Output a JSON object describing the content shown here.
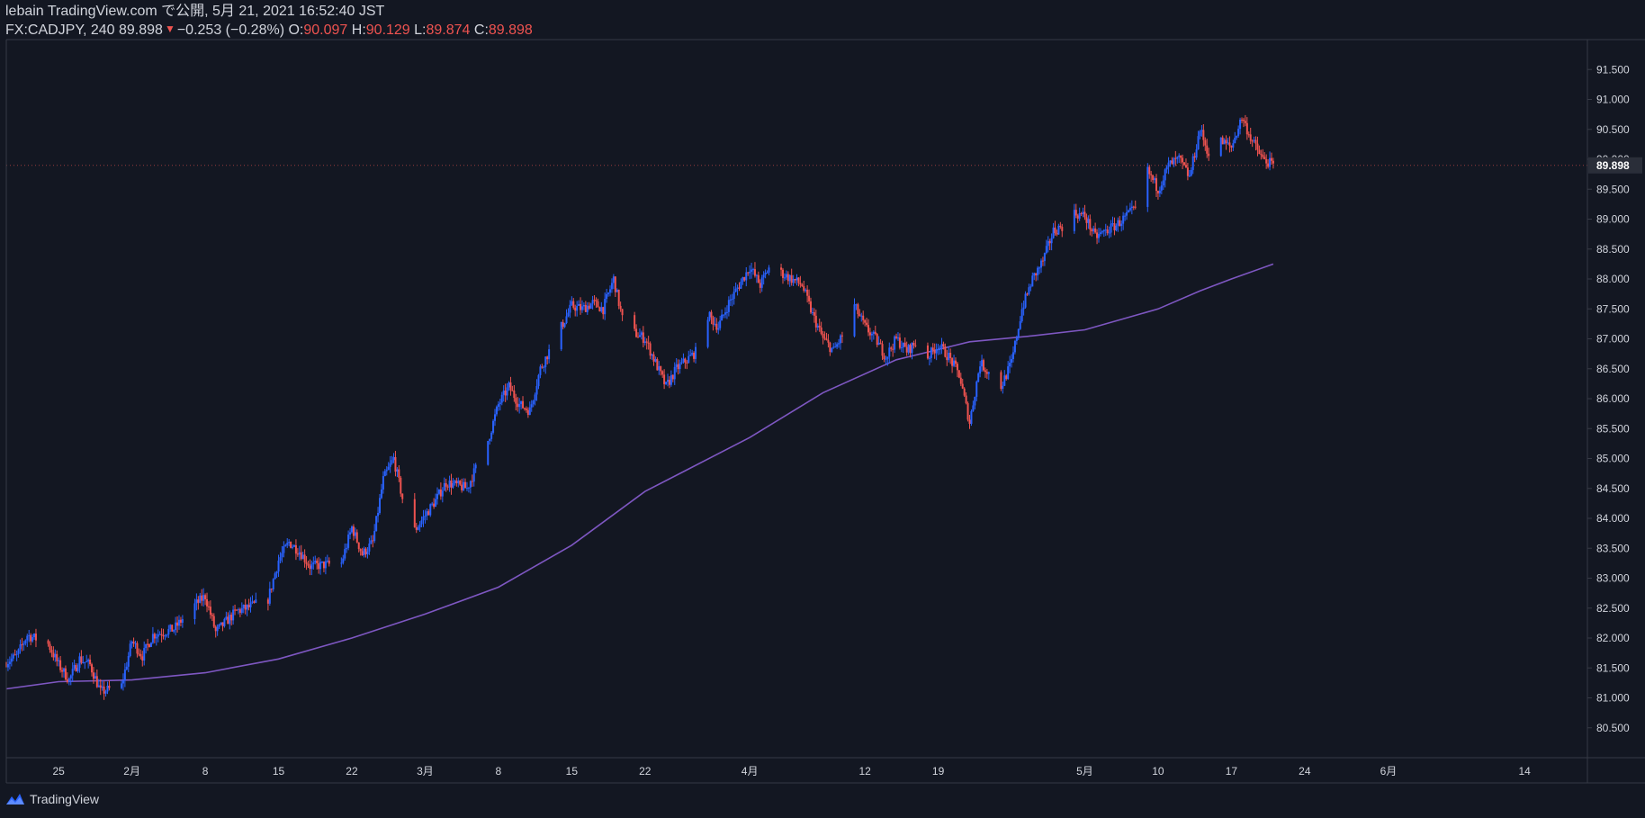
{
  "header": {
    "publish_line": "lebain TradingView.com で公開, 5月 21, 2021 16:52:40 JST",
    "symbol_interval": "FX:CADJPY, 240",
    "last_price": "89.898",
    "change": "−0.253 (−0.28%)",
    "open_label": "O:",
    "open_value": "90.097",
    "high_label": "H:",
    "high_value": "90.129",
    "low_label": "L:",
    "low_value": "89.874",
    "close_label": "C:",
    "close_value": "89.898",
    "down_icon": "triangle-down-icon"
  },
  "footer": {
    "brand": "TradingView",
    "icon": "tradingview-logo-icon"
  },
  "colors": {
    "background": "#131722",
    "up": "#2962ff",
    "down": "#ef5350",
    "ma": "#7e57c2",
    "text": "#d1d4dc",
    "axis_line": "#363a45"
  },
  "chart_data": {
    "type": "candlestick",
    "symbol": "FX:CADJPY",
    "interval": "240",
    "ylim": [
      80.0,
      92.0
    ],
    "y_ticks": [
      "80.500",
      "81.000",
      "81.500",
      "82.000",
      "82.500",
      "83.000",
      "83.500",
      "84.000",
      "84.500",
      "85.000",
      "85.500",
      "86.000",
      "86.500",
      "87.000",
      "87.500",
      "88.000",
      "88.500",
      "89.000",
      "89.500",
      "90.000",
      "90.500",
      "91.000",
      "91.500"
    ],
    "last_price_label": "89.898",
    "x_ticks": [
      {
        "label": "25",
        "date": "2021-01-25"
      },
      {
        "label": "2月",
        "date": "2021-02-01"
      },
      {
        "label": "8",
        "date": "2021-02-08"
      },
      {
        "label": "15",
        "date": "2021-02-15"
      },
      {
        "label": "22",
        "date": "2021-02-22"
      },
      {
        "label": "3月",
        "date": "2021-03-01"
      },
      {
        "label": "8",
        "date": "2021-03-08"
      },
      {
        "label": "15",
        "date": "2021-03-15"
      },
      {
        "label": "22",
        "date": "2021-03-22"
      },
      {
        "label": "4月",
        "date": "2021-04-01"
      },
      {
        "label": "12",
        "date": "2021-04-12"
      },
      {
        "label": "19",
        "date": "2021-04-19"
      },
      {
        "label": "5月",
        "date": "2021-05-03"
      },
      {
        "label": "10",
        "date": "2021-05-10"
      },
      {
        "label": "17",
        "date": "2021-05-17"
      },
      {
        "label": "24",
        "date": "2021-05-24"
      },
      {
        "label": "6月",
        "date": "2021-06-01"
      },
      {
        "label": "14",
        "date": "2021-06-14"
      }
    ],
    "price_path": [
      [
        "2021-01-20",
        81.6
      ],
      [
        "2021-01-21",
        81.7
      ],
      [
        "2021-01-22",
        82.05
      ],
      [
        "2021-01-24",
        81.9
      ],
      [
        "2021-01-25",
        81.55
      ],
      [
        "2021-01-26",
        81.3
      ],
      [
        "2021-01-27",
        81.65
      ],
      [
        "2021-01-28",
        81.55
      ],
      [
        "2021-01-29",
        81.1
      ],
      [
        "2021-01-31",
        81.2
      ],
      [
        "2021-02-01",
        81.95
      ],
      [
        "2021-02-02",
        81.7
      ],
      [
        "2021-02-03",
        82.05
      ],
      [
        "2021-02-05",
        82.15
      ],
      [
        "2021-02-07",
        82.55
      ],
      [
        "2021-02-08",
        82.7
      ],
      [
        "2021-02-09",
        82.1
      ],
      [
        "2021-02-11",
        82.45
      ],
      [
        "2021-02-12",
        82.5
      ],
      [
        "2021-02-14",
        82.65
      ],
      [
        "2021-02-15",
        83.3
      ],
      [
        "2021-02-16",
        83.6
      ],
      [
        "2021-02-17",
        83.45
      ],
      [
        "2021-02-18",
        83.2
      ],
      [
        "2021-02-21",
        83.25
      ],
      [
        "2021-02-22",
        83.85
      ],
      [
        "2021-02-23",
        83.4
      ],
      [
        "2021-02-24",
        83.6
      ],
      [
        "2021-02-25",
        84.65
      ],
      [
        "2021-02-26",
        85.0
      ],
      [
        "2021-02-27",
        84.2
      ],
      [
        "2021-02-28",
        83.8
      ],
      [
        "2021-03-02",
        84.3
      ],
      [
        "2021-03-03",
        84.6
      ],
      [
        "2021-03-05",
        84.5
      ],
      [
        "2021-03-07",
        85.3
      ],
      [
        "2021-03-08",
        85.9
      ],
      [
        "2021-03-09",
        86.2
      ],
      [
        "2021-03-10",
        85.9
      ],
      [
        "2021-03-11",
        85.8
      ],
      [
        "2021-03-12",
        86.5
      ],
      [
        "2021-03-14",
        87.2
      ],
      [
        "2021-03-15",
        87.55
      ],
      [
        "2021-03-16",
        87.5
      ],
      [
        "2021-03-17",
        87.6
      ],
      [
        "2021-03-18",
        87.5
      ],
      [
        "2021-03-19",
        88.0
      ],
      [
        "2021-03-20",
        87.2
      ],
      [
        "2021-03-22",
        87.0
      ],
      [
        "2021-03-23",
        86.6
      ],
      [
        "2021-03-24",
        86.2
      ],
      [
        "2021-03-25",
        86.5
      ],
      [
        "2021-03-27",
        86.8
      ],
      [
        "2021-03-28",
        87.4
      ],
      [
        "2021-03-29",
        87.2
      ],
      [
        "2021-03-30",
        87.6
      ],
      [
        "2021-03-31",
        87.9
      ],
      [
        "2021-04-01",
        88.2
      ],
      [
        "2021-04-02",
        87.9
      ],
      [
        "2021-04-03",
        88.25
      ],
      [
        "2021-04-04",
        88.1
      ],
      [
        "2021-04-05",
        88.0
      ],
      [
        "2021-04-06",
        87.9
      ],
      [
        "2021-04-07",
        87.4
      ],
      [
        "2021-04-08",
        87.0
      ],
      [
        "2021-04-09",
        86.8
      ],
      [
        "2021-04-10",
        87.1
      ],
      [
        "2021-04-11",
        87.55
      ],
      [
        "2021-04-12",
        87.2
      ],
      [
        "2021-04-13",
        87.0
      ],
      [
        "2021-04-14",
        86.7
      ],
      [
        "2021-04-15",
        87.0
      ],
      [
        "2021-04-16",
        86.8
      ],
      [
        "2021-04-17",
        86.95
      ],
      [
        "2021-04-18",
        86.7
      ],
      [
        "2021-04-19",
        86.9
      ],
      [
        "2021-04-20",
        86.7
      ],
      [
        "2021-04-21",
        86.4
      ],
      [
        "2021-04-22",
        85.6
      ],
      [
        "2021-04-23",
        86.6
      ],
      [
        "2021-04-24",
        86.4
      ],
      [
        "2021-04-25",
        86.2
      ],
      [
        "2021-04-26",
        86.6
      ],
      [
        "2021-04-27",
        87.5
      ],
      [
        "2021-04-28",
        88.0
      ],
      [
        "2021-04-29",
        88.3
      ],
      [
        "2021-04-30",
        88.8
      ],
      [
        "2021-05-01",
        88.9
      ],
      [
        "2021-05-02",
        89.1
      ],
      [
        "2021-05-03",
        89.05
      ],
      [
        "2021-05-04",
        88.7
      ],
      [
        "2021-05-05",
        88.8
      ],
      [
        "2021-05-06",
        88.9
      ],
      [
        "2021-05-07",
        89.05
      ],
      [
        "2021-05-08",
        89.2
      ],
      [
        "2021-05-09",
        89.8
      ],
      [
        "2021-05-10",
        89.5
      ],
      [
        "2021-05-11",
        89.9
      ],
      [
        "2021-05-12",
        90.0
      ],
      [
        "2021-05-13",
        89.7
      ],
      [
        "2021-05-14",
        90.5
      ],
      [
        "2021-05-15",
        90.0
      ],
      [
        "2021-05-16",
        90.3
      ],
      [
        "2021-05-17",
        90.2
      ],
      [
        "2021-05-18",
        90.7
      ],
      [
        "2021-05-19",
        90.3
      ],
      [
        "2021-05-20",
        90.0
      ],
      [
        "2021-05-21",
        89.898
      ]
    ],
    "ma_path": [
      [
        "2021-01-20",
        81.15
      ],
      [
        "2021-01-25",
        81.27
      ],
      [
        "2021-02-01",
        81.3
      ],
      [
        "2021-02-08",
        81.42
      ],
      [
        "2021-02-15",
        81.65
      ],
      [
        "2021-02-22",
        82.0
      ],
      [
        "2021-03-01",
        82.4
      ],
      [
        "2021-03-08",
        82.85
      ],
      [
        "2021-03-15",
        83.55
      ],
      [
        "2021-03-22",
        84.45
      ],
      [
        "2021-04-01",
        85.35
      ],
      [
        "2021-04-08",
        86.1
      ],
      [
        "2021-04-15",
        86.65
      ],
      [
        "2021-04-22",
        86.95
      ],
      [
        "2021-04-28",
        87.05
      ],
      [
        "2021-05-03",
        87.15
      ],
      [
        "2021-05-10",
        87.5
      ],
      [
        "2021-05-14",
        87.8
      ],
      [
        "2021-05-17",
        88.0
      ],
      [
        "2021-05-21",
        88.25
      ]
    ]
  }
}
